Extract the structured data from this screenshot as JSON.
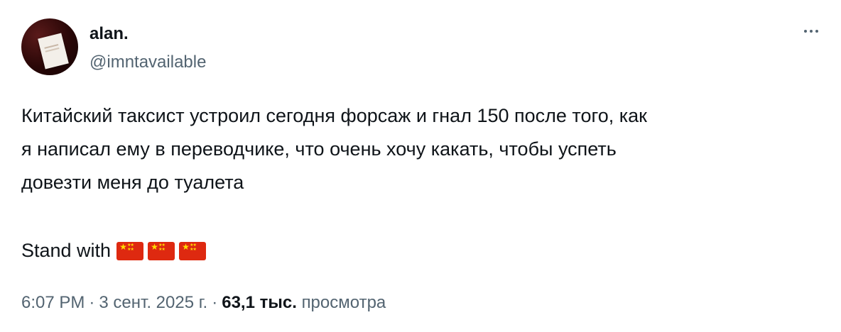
{
  "author": {
    "display_name": "alan.",
    "handle": "@imntavailable"
  },
  "more_icon": "more-horizontal-icon",
  "tweet": {
    "lines": [
      "Китайский таксист устроил сегодня форсаж и гнал 150 после того, как",
      "я написал ему в переводчике, что очень хочу какать, чтобы успеть",
      "довезти меня до туалета"
    ],
    "stand_text": "Stand with",
    "flags": [
      "china-flag-icon",
      "china-flag-icon",
      "china-flag-icon"
    ]
  },
  "meta": {
    "time": "6:07 PM",
    "separator": "·",
    "date": "3 сент. 2025 г.",
    "views_count": "63,1 тыс.",
    "views_label": "просмотра"
  },
  "colors": {
    "text_primary": "#0f1419",
    "text_secondary": "#536471",
    "flag_red": "#de2910",
    "flag_yellow": "#ffde00"
  }
}
